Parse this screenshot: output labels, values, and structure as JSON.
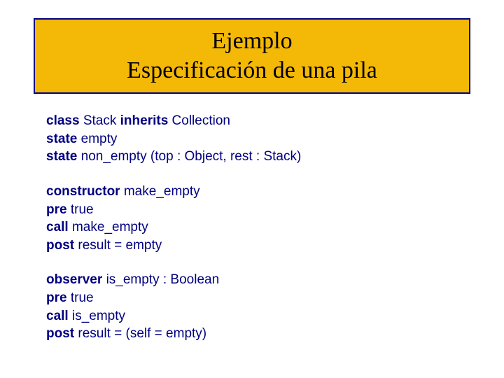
{
  "title": {
    "line1": "Ejemplo",
    "line2": "Especificación de una pila"
  },
  "spec": {
    "class_decl": {
      "kw1": "class",
      "name": "Stack",
      "kw2": "inherits",
      "super": "Collection"
    },
    "state1": {
      "kw": "state",
      "text": "empty"
    },
    "state2": {
      "kw": "state",
      "text": "non_empty (top : Object, rest : Stack)"
    },
    "ctor": {
      "kw": "constructor",
      "name": "make_empty",
      "pre_kw": "pre",
      "pre_val": "true",
      "call_kw": "call",
      "call_val": "make_empty",
      "post_kw": "post",
      "post_val": "result = empty"
    },
    "obs": {
      "kw": "observer",
      "name": "is_empty : Boolean",
      "pre_kw": "pre",
      "pre_val": "true",
      "call_kw": "call",
      "call_val": "is_empty",
      "post_kw": "post",
      "post_val": "result = (self = empty)"
    }
  }
}
